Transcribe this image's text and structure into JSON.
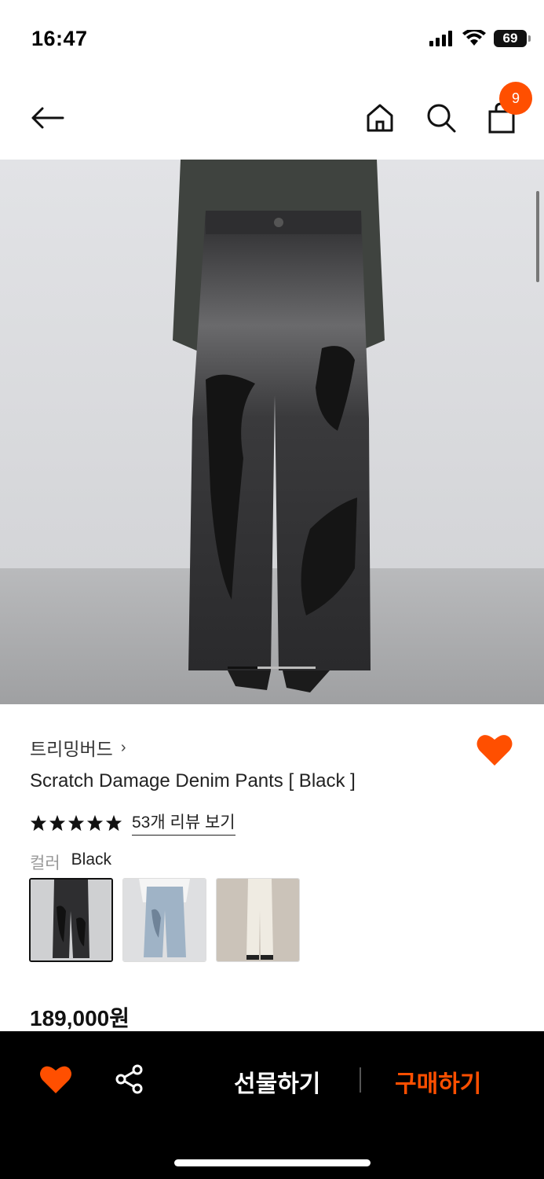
{
  "status_bar": {
    "time": "16:47",
    "battery": "69",
    "icons": [
      "signal-icon",
      "wifi-icon",
      "battery-icon"
    ]
  },
  "header": {
    "icons": [
      "back-arrow-icon",
      "home-icon",
      "search-icon",
      "shopping-bag-icon"
    ],
    "cart_count": "9"
  },
  "product": {
    "brand": "트리밍버드",
    "name": "Scratch Damage Denim Pants [ Black ]",
    "rating_stars": 5,
    "review_link": "53개 리뷰 보기",
    "color_label": "컬러",
    "color_value": "Black",
    "swatches": [
      {
        "name": "Black",
        "selected": true
      },
      {
        "name": "Light Blue",
        "selected": false
      },
      {
        "name": "Ivory",
        "selected": false
      }
    ],
    "price": "189,000원",
    "wishlisted": true
  },
  "bottom_bar": {
    "gift_label": "선물하기",
    "buy_label": "구매하기"
  },
  "colors": {
    "accent": "#ff4f00",
    "bottom_bar_bg": "#000000"
  }
}
